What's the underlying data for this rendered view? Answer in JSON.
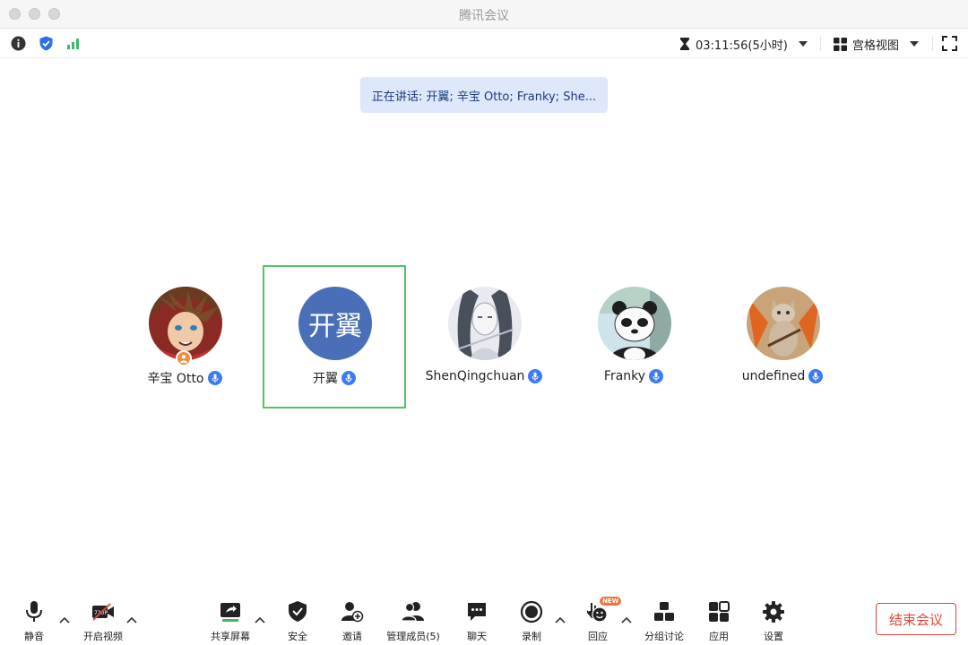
{
  "window": {
    "title": "腾讯会议"
  },
  "statusbar": {
    "timer": "03:11:56(5小时)",
    "layout_label": "宫格视图"
  },
  "speaking_banner": "正在讲话: 开翼; 辛宝 Otto; Franky; She...",
  "participants": [
    {
      "name": "辛宝 Otto",
      "avatar": "anime-avatar",
      "host": true,
      "mic": "on"
    },
    {
      "name": "开翼",
      "avatar_text": "开翼",
      "active_speaker": true,
      "mic": "on"
    },
    {
      "name": "ShenQingchuan",
      "avatar": "ink-drawing-avatar",
      "mic": "on"
    },
    {
      "name": "Franky",
      "avatar": "panda-avatar",
      "mic": "on"
    },
    {
      "name": "undefined",
      "avatar": "cat-avatar",
      "mic": "on"
    }
  ],
  "toolbar": {
    "mute": "静音",
    "video": "开启视频",
    "share": "共享屏幕",
    "security": "安全",
    "invite": "邀请",
    "members": "管理成员(5)",
    "chat": "聊天",
    "record": "录制",
    "reaction": "回应",
    "reaction_badge": "NEW",
    "breakout": "分组讨论",
    "apps": "应用",
    "settings": "设置",
    "end": "结束会议"
  },
  "colors": {
    "accent": "#3b7bf5",
    "active_frame": "#54c26a",
    "end_button": "#e0463a",
    "banner_bg": "#dfe8fb",
    "letter_avatar": "#4a6fb8"
  }
}
